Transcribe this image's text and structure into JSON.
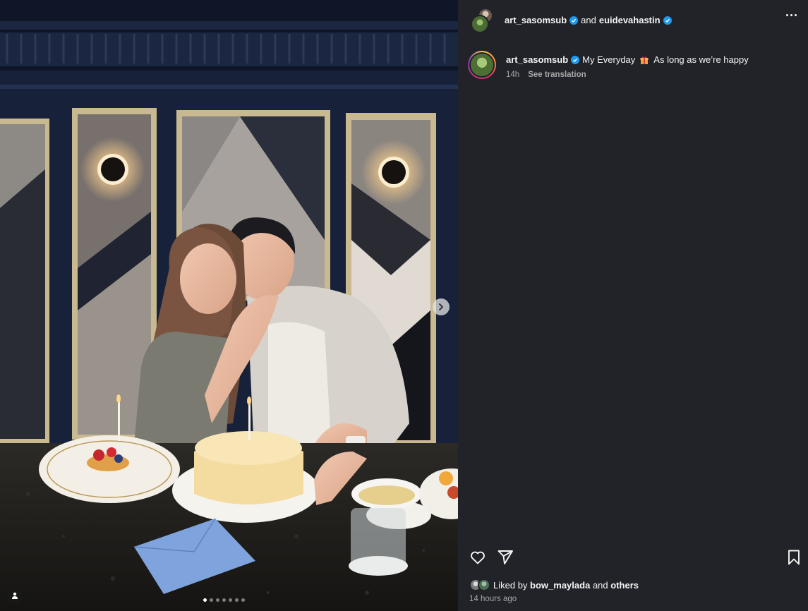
{
  "header": {
    "author": "art_sasomsub",
    "joiner": "and",
    "collaborator": "euidevahastin"
  },
  "caption": {
    "author": "art_sasomsub",
    "text_before": "My Everyday",
    "text_after": "As long as we’re happy",
    "age": "14h",
    "see_translation": "See translation"
  },
  "media": {
    "carousel_total": 7,
    "carousel_active": 1
  },
  "likes": {
    "prefix": "Liked by",
    "user": "bow_maylada",
    "and": "and",
    "others": "others"
  },
  "timestamp": "14 hours ago",
  "colors": {
    "panel_bg": "#212328",
    "verified": "#1d9bf0",
    "text_primary": "#f5f5f5",
    "text_secondary": "#a8a8a8"
  },
  "icons": [
    "heart-icon",
    "share-icon",
    "bookmark-icon",
    "more-options-icon",
    "chevron-right-icon",
    "user-tag-icon",
    "gift-emoji",
    "verified-badge"
  ]
}
